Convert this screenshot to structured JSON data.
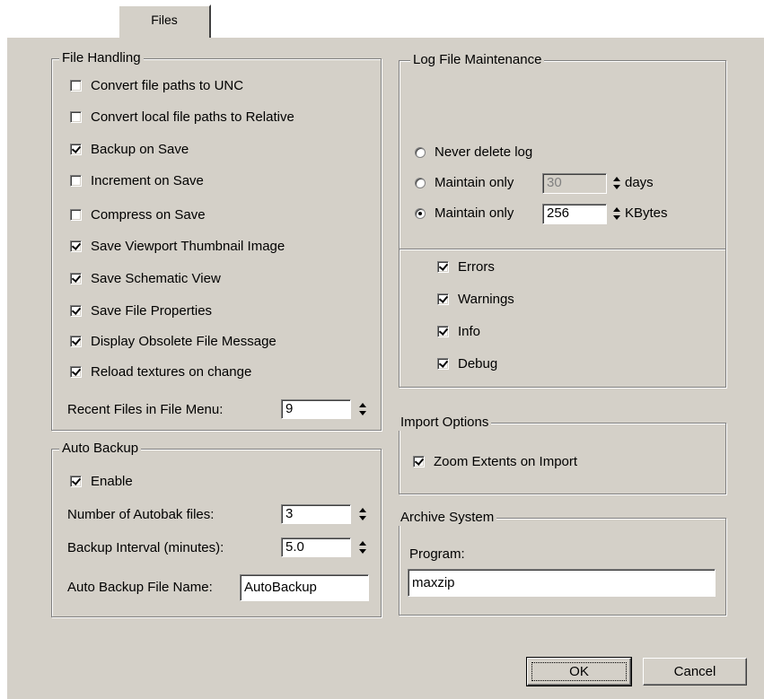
{
  "tab": {
    "label": "Files"
  },
  "file_handling": {
    "title": "File Handling",
    "options": [
      {
        "label": "Convert file paths to UNC",
        "checked": false
      },
      {
        "label": "Convert local file paths to Relative",
        "checked": false
      },
      {
        "label": "Backup on Save",
        "checked": true
      },
      {
        "label": "Increment on Save",
        "checked": false
      },
      {
        "label": "Compress on Save",
        "checked": false
      },
      {
        "label": "Save Viewport Thumbnail Image",
        "checked": true
      },
      {
        "label": "Save Schematic View",
        "checked": true
      },
      {
        "label": "Save File Properties",
        "checked": true
      },
      {
        "label": "Display Obsolete File Message",
        "checked": true
      },
      {
        "label": "Reload textures on change",
        "checked": true
      }
    ],
    "recent_files_label": "Recent Files in File Menu:",
    "recent_files_value": "9"
  },
  "auto_backup": {
    "title": "Auto Backup",
    "enable_label": "Enable",
    "enable_checked": true,
    "num_files_label": "Number of Autobak files:",
    "num_files_value": "3",
    "interval_label": "Backup Interval (minutes):",
    "interval_value": "5.0",
    "filename_label": "Auto Backup File Name:",
    "filename_value": "AutoBackup"
  },
  "log_file": {
    "title": "Log File Maintenance",
    "never_delete_label": "Never delete log",
    "maintain_days_label": "Maintain only",
    "maintain_days_value": "30",
    "days_unit": "days",
    "maintain_kb_label": "Maintain only",
    "maintain_kb_value": "256",
    "kb_unit": "KBytes",
    "selected_option": "kbytes",
    "levels": [
      {
        "label": "Errors",
        "checked": true
      },
      {
        "label": "Warnings",
        "checked": true
      },
      {
        "label": "Info",
        "checked": true
      },
      {
        "label": "Debug",
        "checked": true
      }
    ]
  },
  "import_options": {
    "title": "Import Options",
    "zoom_label": "Zoom Extents on Import",
    "zoom_checked": true
  },
  "archive": {
    "title": "Archive System",
    "program_label": "Program:",
    "program_value": "maxzip"
  },
  "buttons": {
    "ok": "OK",
    "cancel": "Cancel"
  }
}
